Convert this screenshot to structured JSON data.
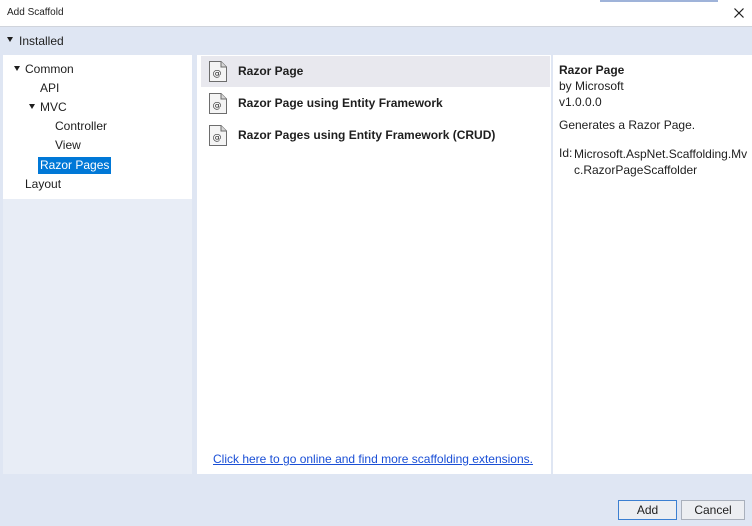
{
  "window": {
    "title": "Add Scaffold"
  },
  "installed": {
    "label": "Installed"
  },
  "tree": {
    "common": "Common",
    "api": "API",
    "mvc": "MVC",
    "controller": "Controller",
    "view": "View",
    "razor_pages": "Razor Pages",
    "layout": "Layout",
    "selected": "Razor Pages"
  },
  "templates": {
    "items": [
      {
        "label": "Razor Page",
        "selected": true
      },
      {
        "label": "Razor Page using Entity Framework",
        "selected": false
      },
      {
        "label": "Razor Pages using Entity Framework (CRUD)",
        "selected": false
      }
    ],
    "online_link": "Click here to go online and find more scaffolding extensions."
  },
  "details": {
    "name": "Razor Page",
    "author": "by Microsoft",
    "version": "v1.0.0.0",
    "description": "Generates a Razor Page.",
    "id_label": "Id:",
    "id_value": "Microsoft.AspNet.Scaffolding.Mvc.RazorPageScaffolder"
  },
  "footer": {
    "add_label": "Add",
    "cancel_label": "Cancel"
  },
  "colors": {
    "selection": "#0078d7",
    "link": "#1a4fd6",
    "dialog_background": "#dfe6f3"
  },
  "icons": {
    "close": "close-icon",
    "template": "razor-template-icon",
    "expand": "expanded-arrow-icon"
  }
}
